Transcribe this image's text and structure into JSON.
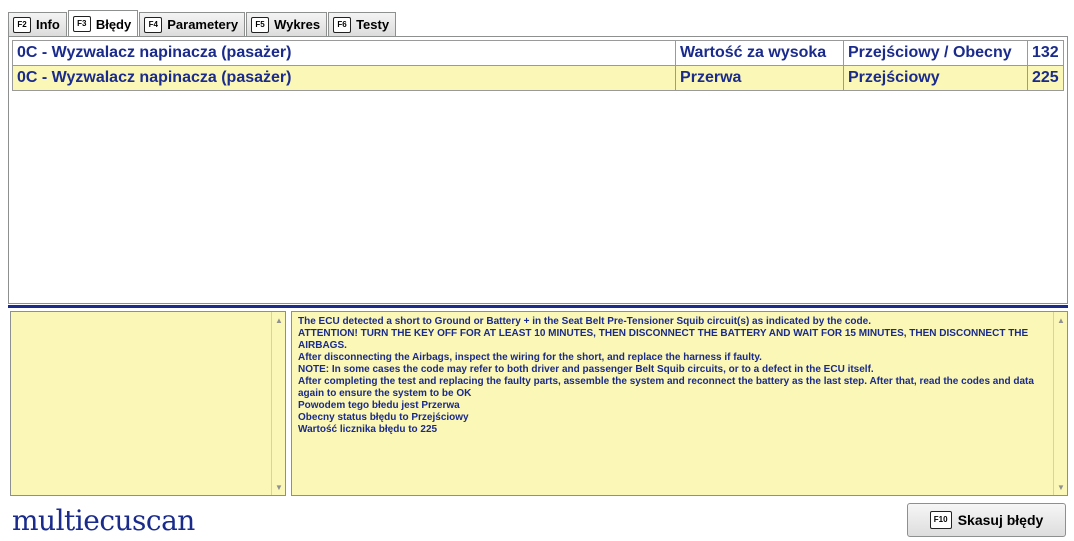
{
  "tabs": [
    {
      "key": "F2",
      "label": "Info",
      "active": false
    },
    {
      "key": "F3",
      "label": "Błędy",
      "active": true
    },
    {
      "key": "F4",
      "label": "Parametery",
      "active": false
    },
    {
      "key": "F5",
      "label": "Wykres",
      "active": false
    },
    {
      "key": "F6",
      "label": "Testy",
      "active": false
    }
  ],
  "faults": [
    {
      "code_desc": "0C - Wyzwalacz napinacza (pasażer)",
      "type": "Wartość za wysoka",
      "status": "Przejściowy / Obecny",
      "count": "132"
    },
    {
      "code_desc": "0C - Wyzwalacz napinacza (pasażer)",
      "type": "Przerwa",
      "status": "Przejściowy",
      "count": "225"
    }
  ],
  "description_lines": [
    "The ECU detected a short to Ground or Battery + in the Seat Belt Pre-Tensioner Squib circuit(s) as indicated by the code.",
    "ATTENTION! TURN THE KEY OFF FOR AT LEAST 10 MINUTES, THEN DISCONNECT THE BATTERY AND WAIT FOR 15 MINUTES, THEN DISCONNECT THE AIRBAGS.",
    "After disconnecting the Airbags, inspect the wiring for the short, and replace the harness if faulty.",
    "NOTE: In some cases the code may refer to both driver and passenger Belt Squib circuits, or to a defect in the ECU itself.",
    "After completing the test and replacing the faulty parts, assemble the system and reconnect the battery as the last step. After that, read the codes and data again to ensure the system to be OK",
    "Powodem tego błedu jest Przerwa",
    "Obecny status błędu to Przejściowy",
    "Wartość licznika błędu to 225"
  ],
  "logo": "multiecuscan",
  "clear_button": {
    "key": "F10",
    "label": "Skasuj błędy"
  },
  "colors": {
    "accent": "#1a2b8c",
    "highlight": "#fbf7b6"
  }
}
